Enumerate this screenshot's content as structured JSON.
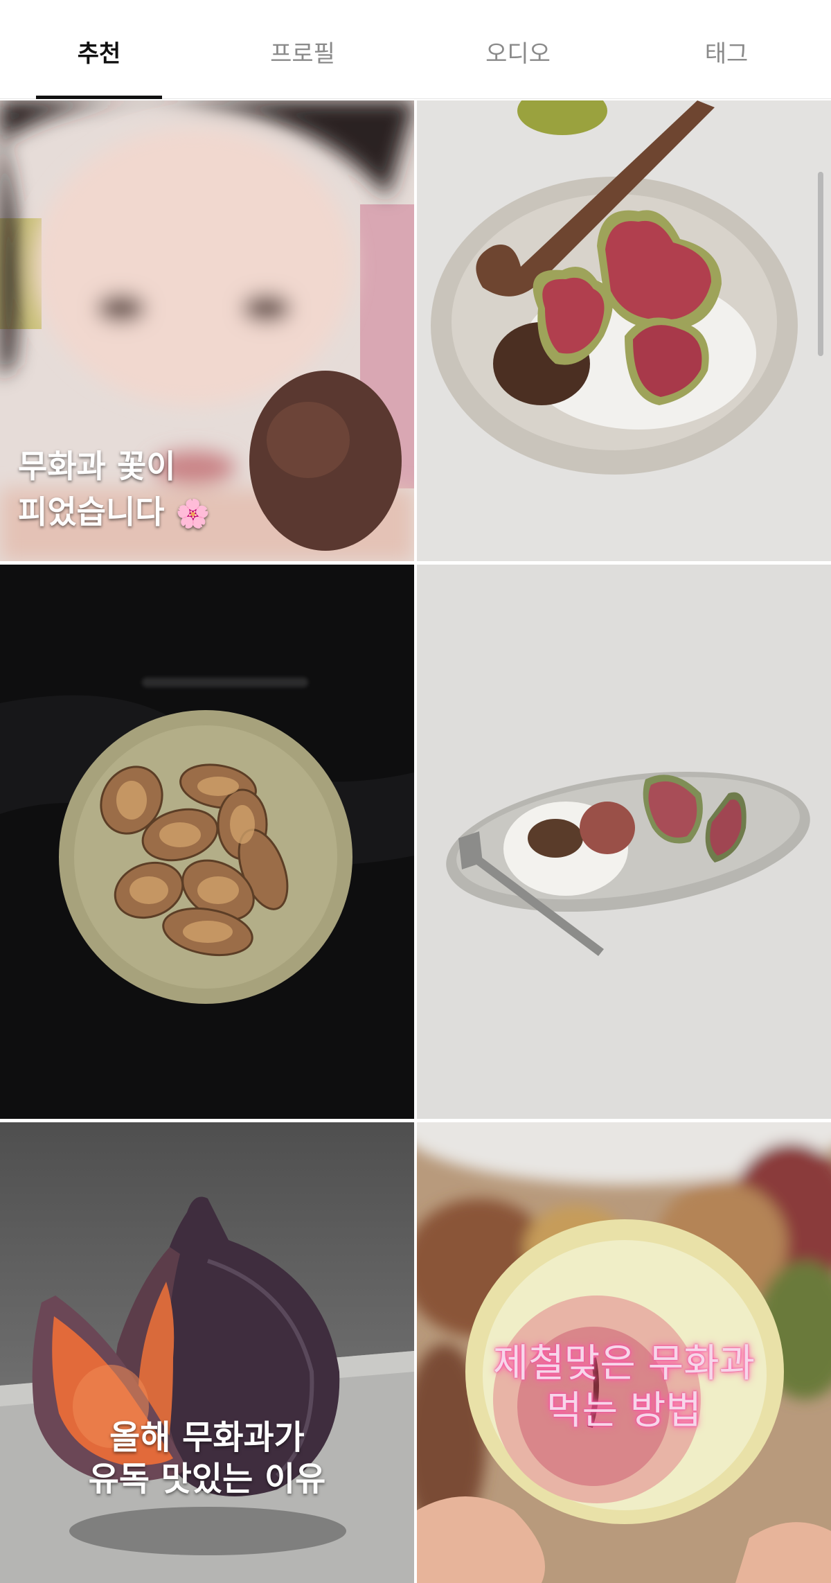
{
  "tabs": [
    {
      "label": "추천",
      "active": true
    },
    {
      "label": "프로필",
      "active": false
    },
    {
      "label": "오디오",
      "active": false
    },
    {
      "label": "태그",
      "active": false
    }
  ],
  "grid": {
    "tiles": [
      {
        "caption": ""
      },
      {
        "caption": ""
      },
      {
        "caption_lines": [
          "무화과 꽃이",
          "피었습니다"
        ]
      },
      {
        "caption": ""
      },
      {
        "caption_lines": [
          "올해 무화과가",
          "유독 맛있는 이유"
        ]
      },
      {
        "caption_lines": [
          "제철맞은 무화과",
          "먹는 방법"
        ]
      }
    ]
  },
  "colors": {
    "active_tab": "#111111",
    "inactive_tab": "#8a8a8a",
    "neon_pink": "#ff5aaa"
  },
  "icons": {
    "caption_emoji": "flower-emoji-icon"
  }
}
